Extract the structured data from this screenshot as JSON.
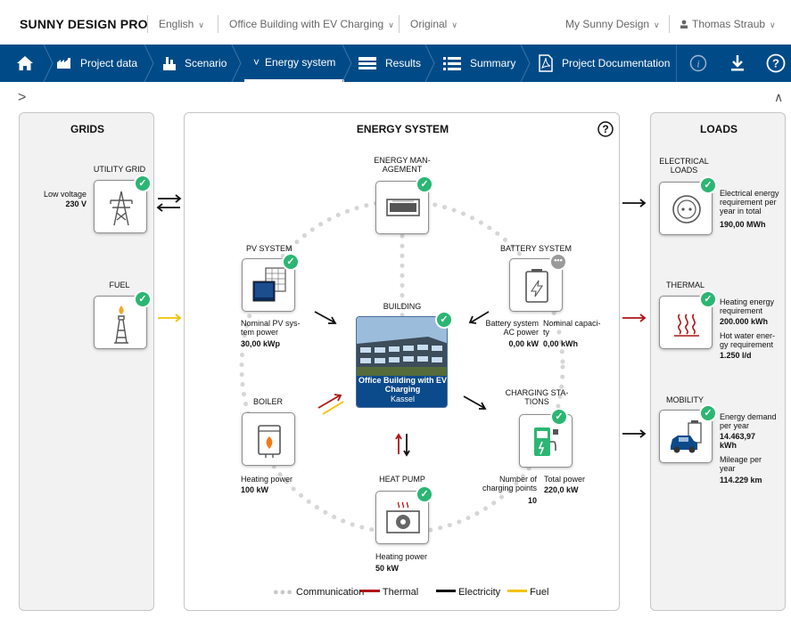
{
  "header": {
    "brand": "SUNNY DESIGN PRO",
    "language": "English",
    "project": "Office Building with EV Charging",
    "variant": "Original",
    "my_sunny_design": "My Sunny Design",
    "user": "Thomas Straub"
  },
  "nav": {
    "project_data": "Project data",
    "scenario": "Scenario",
    "energy_system": "Energy system",
    "results": "Results",
    "summary": "Summary",
    "documentation": "Project Documentation",
    "chevron": "˅"
  },
  "grids": {
    "title": "GRIDS",
    "utility_grid": {
      "label": "UTILITY GRID",
      "k1": "Low voltage",
      "v1": "230 V"
    },
    "fuel": {
      "label": "FUEL"
    }
  },
  "center": {
    "title": "ENERGY SYSTEM",
    "ems": {
      "label": "ENERGY MAN-\nAGEMENT"
    },
    "pv": {
      "label": "PV SYSTEM",
      "k1": "Nominal PV sys-\ntem power",
      "v1": "30,00 kWp"
    },
    "battery": {
      "label": "BATTERY SYSTEM",
      "k1": "Battery system\nAC power",
      "v1": "0,00 kW",
      "k2": "Nominal capaci-\nty",
      "v2": "0,00 kWh"
    },
    "building": {
      "label": "BUILDING",
      "name": "Office Building with EV Charging",
      "city": "Kassel"
    },
    "boiler": {
      "label": "BOILER",
      "k1": "Heating power",
      "v1": "100 kW"
    },
    "charging": {
      "label": "CHARGING STA-\nTIONS",
      "k1": "Number of\ncharging points",
      "v1": "10",
      "k2": "Total power",
      "v2": "220,0 kW"
    },
    "heatpump": {
      "label": "HEAT PUMP",
      "k1": "Heating power",
      "v1": "50 kW"
    }
  },
  "loads": {
    "title": "LOADS",
    "electrical": {
      "label": "ELECTRICAL\nLOADS",
      "k1": "Electrical energy\nrequirement per\nyear in total",
      "v1": "190,00 MWh"
    },
    "thermal": {
      "label": "THERMAL",
      "k1": "Heating energy\nrequirement",
      "v1": "200.000 kWh",
      "k2": "Hot water ener-\ngy requirement",
      "v2": "1.250 l/d"
    },
    "mobility": {
      "label": "MOBILITY",
      "k1": "Energy demand\nper year",
      "v1": "14.463,97\nkWh",
      "k2": "Mileage per\nyear",
      "v2": "114.229 km"
    }
  },
  "legend": {
    "communication": "Communication",
    "thermal": "Thermal",
    "electricity": "Electricity",
    "fuel": "Fuel"
  },
  "colors": {
    "navy": "#004b87",
    "check": "#2bb673",
    "thermal": "#b01515",
    "fuel": "#f2c200",
    "electricity": "#111111",
    "communication": "#c8c8c8"
  }
}
